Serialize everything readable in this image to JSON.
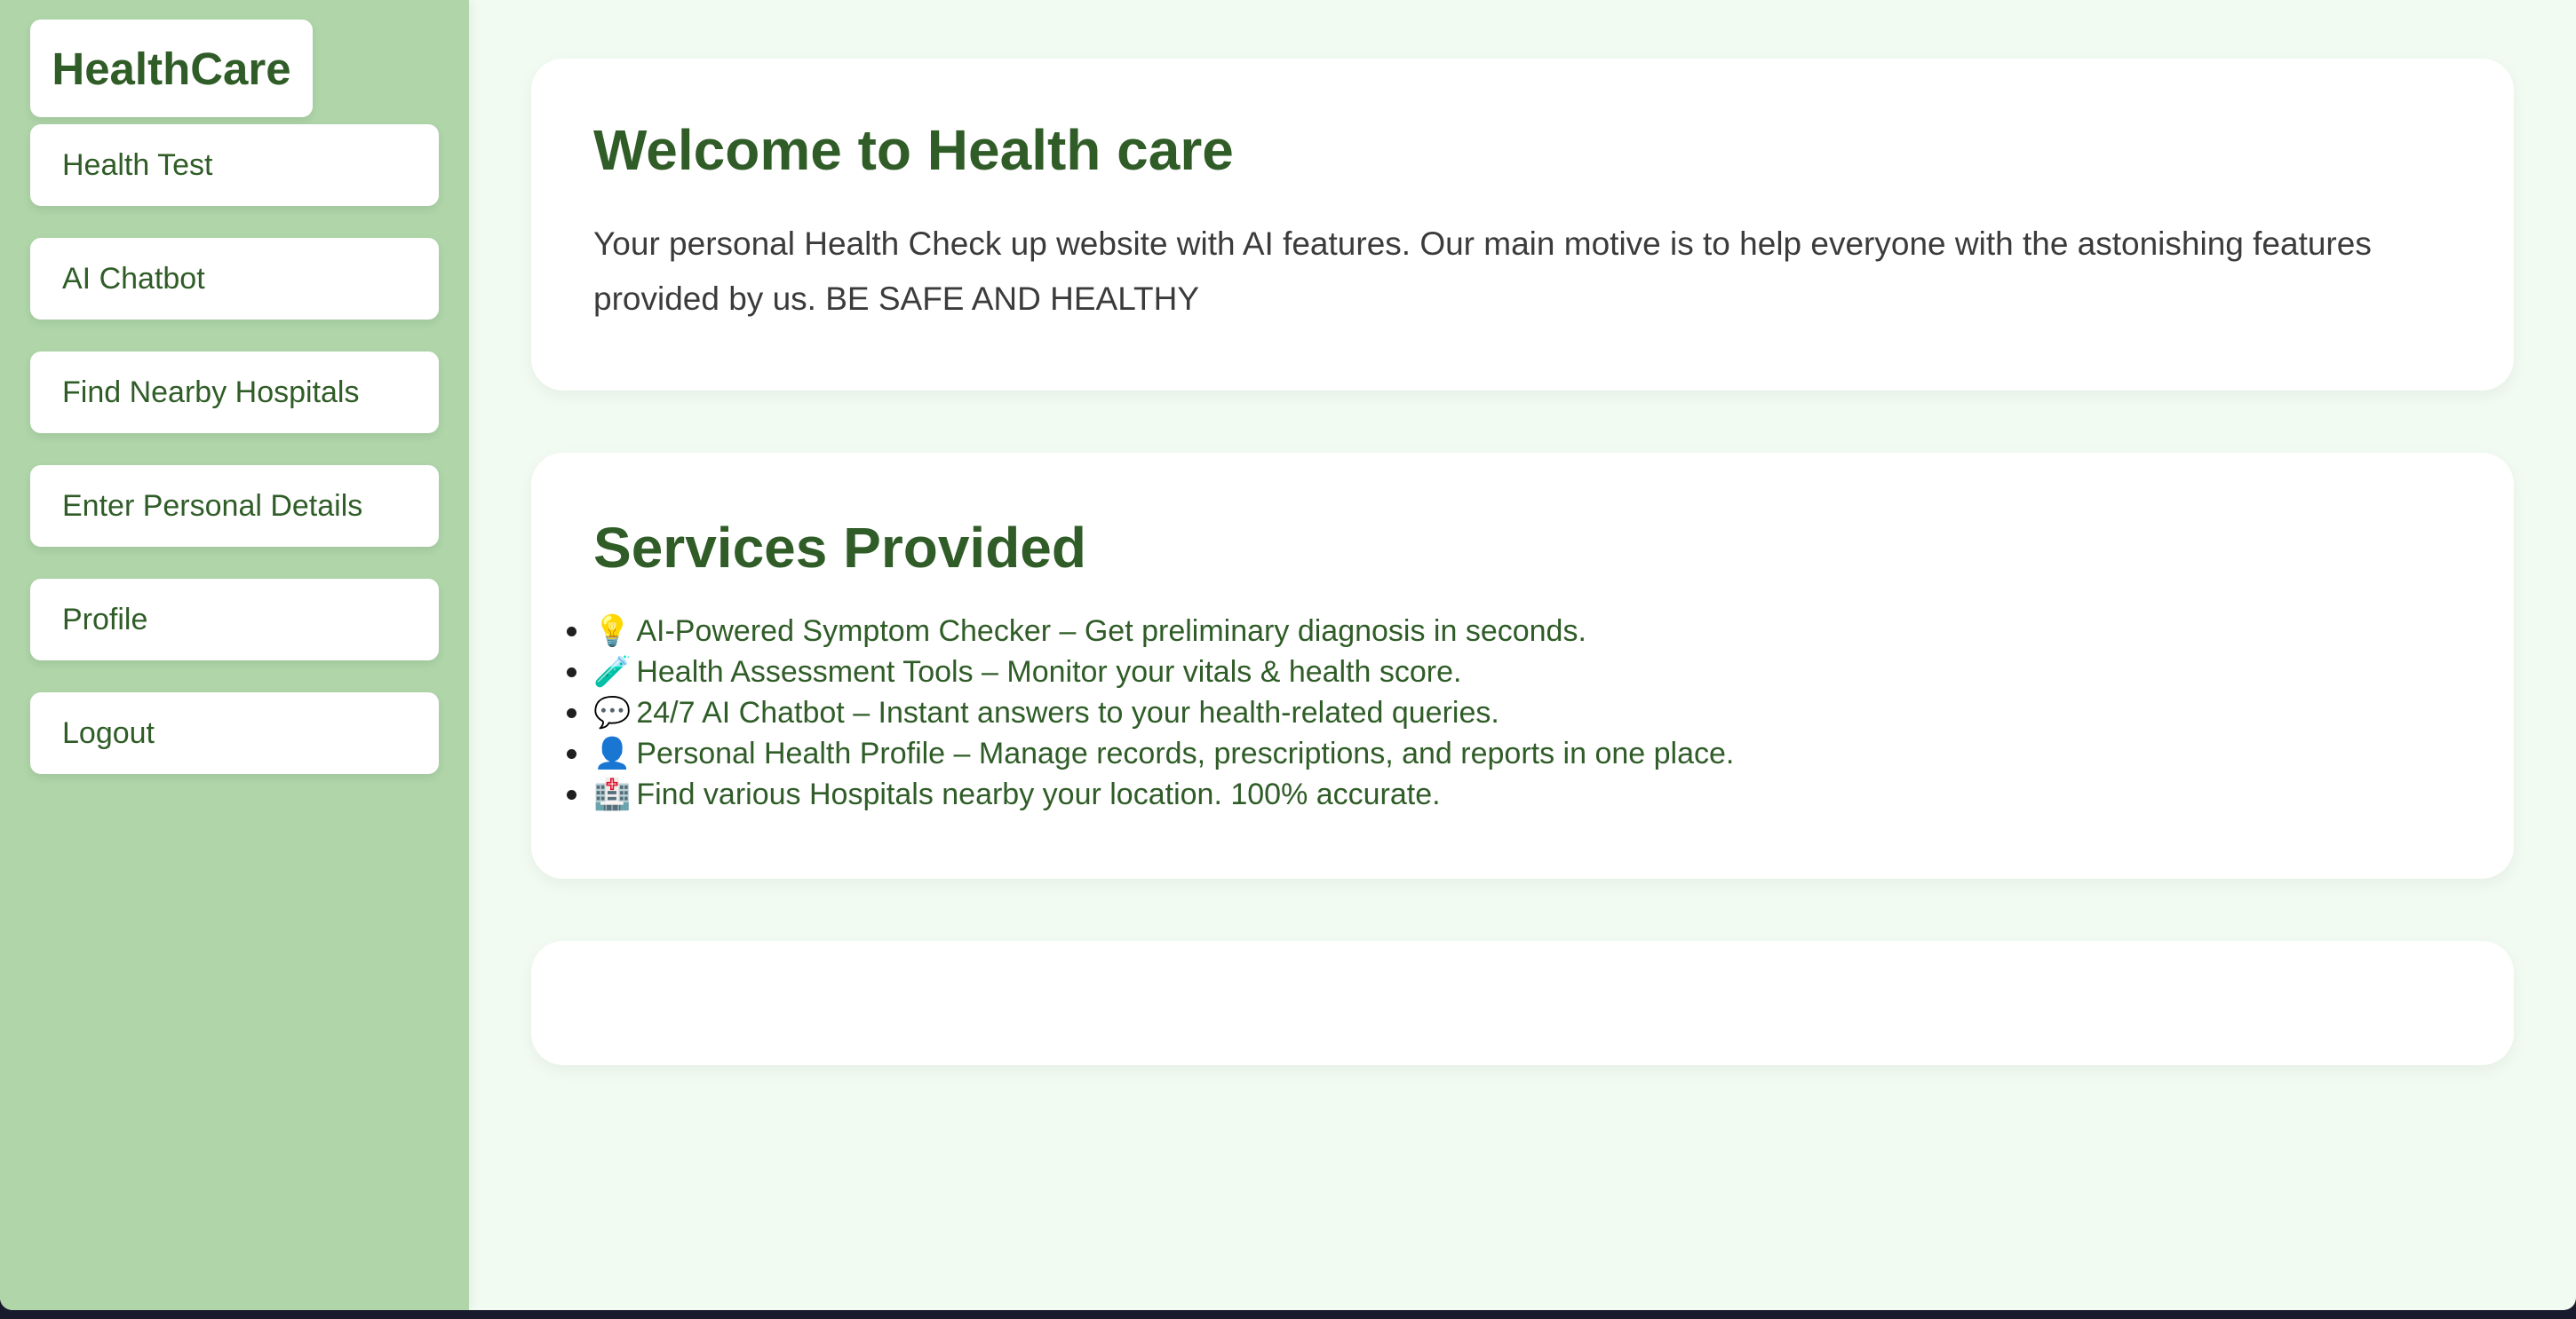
{
  "sidebar": {
    "brand": "HealthCare",
    "items": [
      {
        "label": "Health Test"
      },
      {
        "label": "AI Chatbot"
      },
      {
        "label": "Find Nearby Hospitals"
      },
      {
        "label": "Enter Personal Details"
      },
      {
        "label": "Profile"
      },
      {
        "label": "Logout"
      }
    ]
  },
  "welcome": {
    "title": "Welcome to Health care",
    "text": "Your personal Health Check up website with AI features. Our main motive is to help everyone with the astonishing features provided by us. BE SAFE AND HEALTHY"
  },
  "services": {
    "title": "Services Provided",
    "items": [
      {
        "emoji": "💡",
        "icon": "lightbulb-icon",
        "text": "AI-Powered Symptom Checker – Get preliminary diagnosis in seconds."
      },
      {
        "emoji": "🧪",
        "icon": "test-tube-icon",
        "text": "Health Assessment Tools – Monitor your vitals & health score."
      },
      {
        "emoji": "💬",
        "icon": "speech-bubble-icon",
        "text": "24/7 AI Chatbot – Instant answers to your health-related queries."
      },
      {
        "emoji": "👤",
        "icon": "user-silhouette-icon",
        "text": "Personal Health Profile – Manage records, prescriptions, and reports in one place."
      },
      {
        "emoji": "🏥",
        "icon": "hospital-icon",
        "text": "Find various Hospitals nearby your location. 100% accurate."
      }
    ]
  },
  "colors": {
    "sidebar_bg": "#afd5a9",
    "page_bg": "#f1fbf2",
    "accent": "#2f5c27",
    "body_text": "#3b3b3b"
  }
}
